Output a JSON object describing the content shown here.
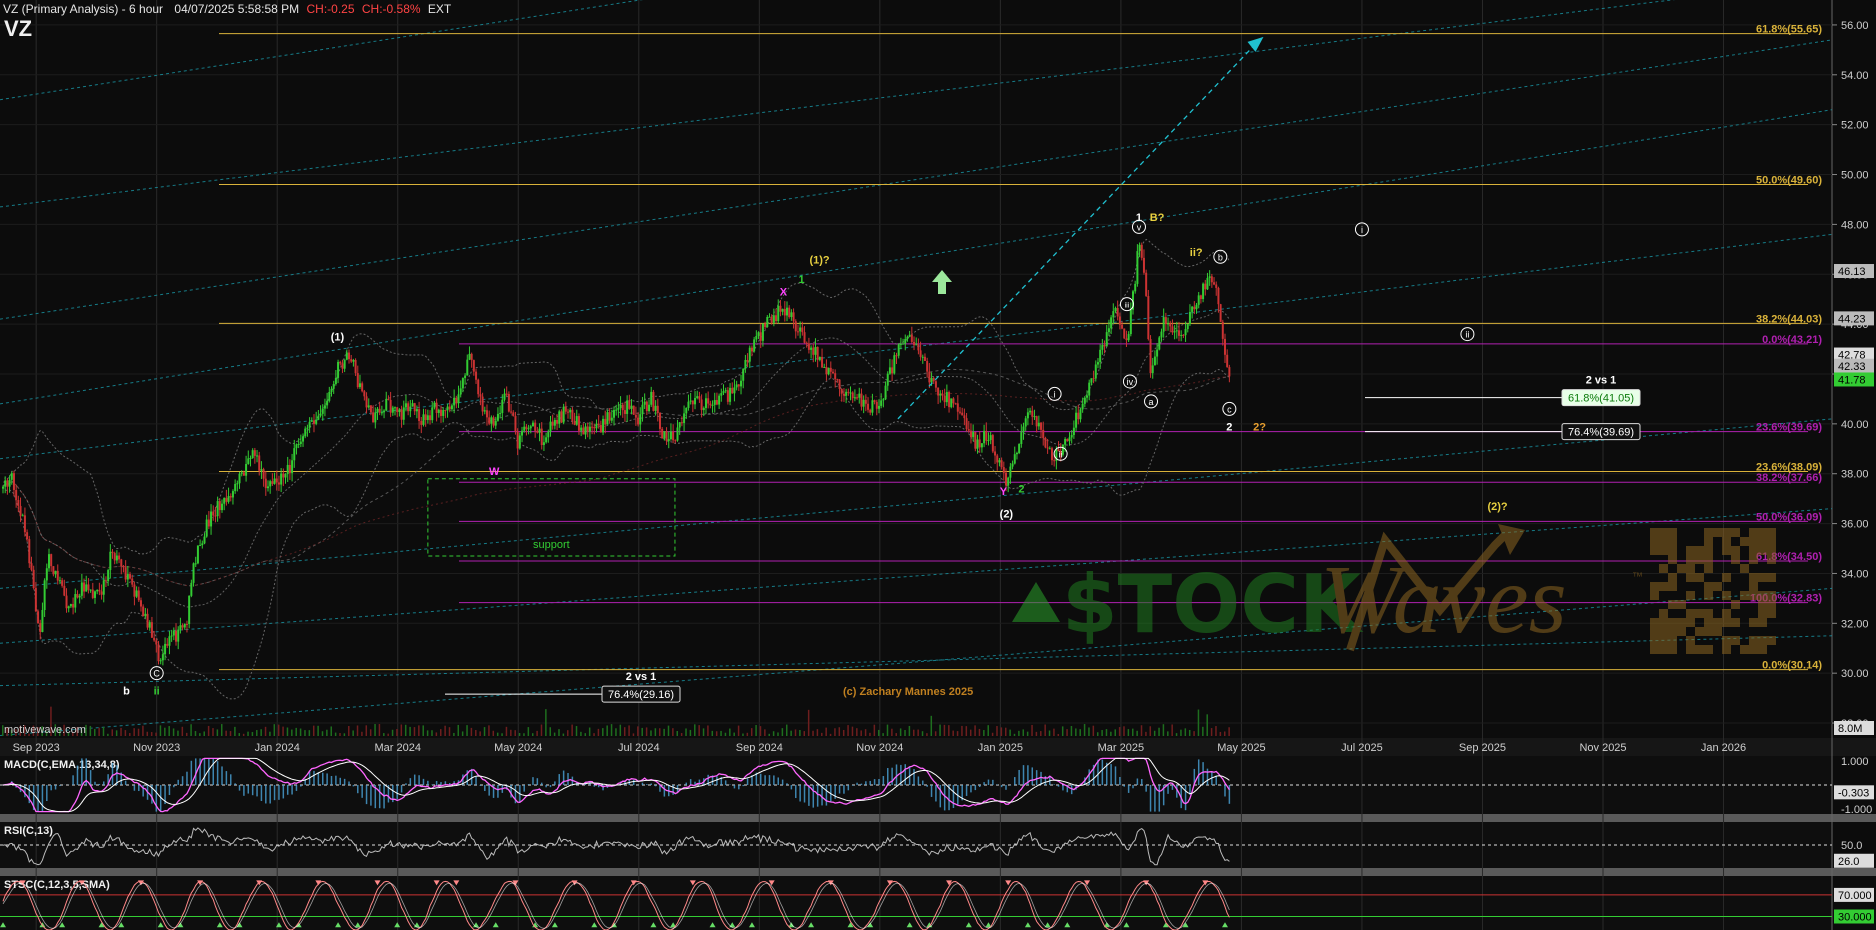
{
  "header": {
    "title": "VZ (Primary Analysis) - 6 hour",
    "datetime": "04/07/2025 5:58:58 PM",
    "change": "CH:-0.25",
    "change_pct": "CH:-0.58%",
    "session": "EXT",
    "symbol": "VZ"
  },
  "watermark": {
    "site": "motivewave.com",
    "copyright": "(c) Zachary Mannes 2025",
    "logo_text_1": "$TOCK",
    "logo_text_2": "Waves",
    "tm": "™"
  },
  "colors": {
    "background": "#0c0c0c",
    "up_candle": "#33cc33",
    "down_candle": "#cc3333",
    "fib_gold": "#d9b23a",
    "fib_magenta": "#b020b0",
    "channel_cyan": "#1aa0b0",
    "macd_line": "#ff66ff",
    "macd_signal": "#ffffff",
    "macd_hist": "#4aa3d8",
    "rsi_line": "#bbbbbb",
    "stoch_k": "#ff8888",
    "stoch_d": "#ffffff"
  },
  "chart_data": [
    {
      "type": "candlestick",
      "xlabel": "",
      "ylabel": "",
      "x_ticks": [
        "Sep 2023",
        "Nov 2023",
        "Jan 2024",
        "Mar 2024",
        "May 2024",
        "Jul 2024",
        "Sep 2024",
        "Nov 2024",
        "Jan 2025",
        "Mar 2025",
        "May 2025",
        "Jul 2025",
        "Sep 2025",
        "Nov 2025",
        "Jan 2026"
      ],
      "x_tick_months": [
        0,
        2,
        4,
        6,
        8,
        10,
        12,
        14,
        16,
        18,
        20,
        22,
        24,
        26,
        28
      ],
      "x_range_months": [
        -0.6,
        29.8
      ],
      "ylim": [
        27.4,
        57.0
      ],
      "y_ticks": [
        28.0,
        30.0,
        32.0,
        34.0,
        36.0,
        38.0,
        40.0,
        42.0,
        44.0,
        46.0,
        48.0,
        50.0,
        52.0,
        54.0,
        56.0
      ],
      "price_tags": [
        {
          "label": "46.13",
          "value": 46.13,
          "bg": "#bbbbbb",
          "fg": "#000000"
        },
        {
          "label": "44.23",
          "value": 44.23,
          "bg": "#bbbbbb",
          "fg": "#000000"
        },
        {
          "label": "42.78",
          "value": 42.78,
          "bg": "#dddddd",
          "fg": "#000000"
        },
        {
          "label": "42.33",
          "value": 42.33,
          "bg": "#bbbbbb",
          "fg": "#000000"
        },
        {
          "label": "41.78",
          "value": 41.78,
          "bg": "#33cc33",
          "fg": "#000000"
        }
      ],
      "volume_tag": "8.0M",
      "price_path": [
        {
          "m": -0.55,
          "p": 37.4
        },
        {
          "m": -0.4,
          "p": 37.8
        },
        {
          "m": -0.25,
          "p": 36.5
        },
        {
          "m": -0.1,
          "p": 34.5
        },
        {
          "m": 0.05,
          "p": 31.4
        },
        {
          "m": 0.2,
          "p": 34.8
        },
        {
          "m": 0.35,
          "p": 33.8
        },
        {
          "m": 0.55,
          "p": 32.6
        },
        {
          "m": 0.75,
          "p": 33.5
        },
        {
          "m": 0.95,
          "p": 33.0
        },
        {
          "m": 1.1,
          "p": 33.2
        },
        {
          "m": 1.25,
          "p": 35.0
        },
        {
          "m": 1.45,
          "p": 34.2
        },
        {
          "m": 1.65,
          "p": 33.2
        },
        {
          "m": 1.85,
          "p": 32.0
        },
        {
          "m": 2.0,
          "p": 31.0
        },
        {
          "m": 2.05,
          "p": 30.6
        },
        {
          "m": 2.2,
          "p": 31.2
        },
        {
          "m": 2.35,
          "p": 31.6
        },
        {
          "m": 2.5,
          "p": 32.2
        },
        {
          "m": 2.6,
          "p": 34.3
        },
        {
          "m": 2.8,
          "p": 35.8
        },
        {
          "m": 3.0,
          "p": 36.6
        },
        {
          "m": 3.2,
          "p": 37.2
        },
        {
          "m": 3.4,
          "p": 37.8
        },
        {
          "m": 3.6,
          "p": 38.9
        },
        {
          "m": 3.8,
          "p": 37.6
        },
        {
          "m": 4.0,
          "p": 37.8
        },
        {
          "m": 4.2,
          "p": 38.2
        },
        {
          "m": 4.4,
          "p": 39.6
        },
        {
          "m": 4.6,
          "p": 39.9
        },
        {
          "m": 4.8,
          "p": 40.8
        },
        {
          "m": 5.0,
          "p": 42.3
        },
        {
          "m": 5.2,
          "p": 42.8
        },
        {
          "m": 5.4,
          "p": 41.2
        },
        {
          "m": 5.6,
          "p": 40.2
        },
        {
          "m": 5.8,
          "p": 40.9
        },
        {
          "m": 6.0,
          "p": 40.3
        },
        {
          "m": 6.2,
          "p": 40.8
        },
        {
          "m": 6.4,
          "p": 40.1
        },
        {
          "m": 6.6,
          "p": 40.6
        },
        {
          "m": 6.8,
          "p": 40.4
        },
        {
          "m": 7.0,
          "p": 41.2
        },
        {
          "m": 7.2,
          "p": 42.9
        },
        {
          "m": 7.4,
          "p": 40.6
        },
        {
          "m": 7.6,
          "p": 40.1
        },
        {
          "m": 7.8,
          "p": 41.2
        },
        {
          "m": 8.0,
          "p": 39.2
        },
        {
          "m": 8.2,
          "p": 40.0
        },
        {
          "m": 8.4,
          "p": 39.4
        },
        {
          "m": 8.6,
          "p": 40.1
        },
        {
          "m": 8.8,
          "p": 40.5
        },
        {
          "m": 9.0,
          "p": 40.0
        },
        {
          "m": 9.2,
          "p": 39.6
        },
        {
          "m": 9.4,
          "p": 39.9
        },
        {
          "m": 9.6,
          "p": 40.6
        },
        {
          "m": 9.8,
          "p": 40.7
        },
        {
          "m": 10.0,
          "p": 40.2
        },
        {
          "m": 10.2,
          "p": 41.1
        },
        {
          "m": 10.4,
          "p": 39.6
        },
        {
          "m": 10.6,
          "p": 39.3
        },
        {
          "m": 10.8,
          "p": 40.8
        },
        {
          "m": 11.0,
          "p": 40.9
        },
        {
          "m": 11.2,
          "p": 40.6
        },
        {
          "m": 11.4,
          "p": 41.1
        },
        {
          "m": 11.6,
          "p": 41.2
        },
        {
          "m": 11.8,
          "p": 42.6
        },
        {
          "m": 12.0,
          "p": 43.5
        },
        {
          "m": 12.2,
          "p": 44.3
        },
        {
          "m": 12.4,
          "p": 44.6
        },
        {
          "m": 12.6,
          "p": 44.0
        },
        {
          "m": 12.8,
          "p": 43.3
        },
        {
          "m": 13.0,
          "p": 42.6
        },
        {
          "m": 13.2,
          "p": 42.0
        },
        {
          "m": 13.4,
          "p": 41.4
        },
        {
          "m": 13.6,
          "p": 41.2
        },
        {
          "m": 13.8,
          "p": 40.6
        },
        {
          "m": 14.0,
          "p": 40.9
        },
        {
          "m": 14.2,
          "p": 42.2
        },
        {
          "m": 14.4,
          "p": 43.6
        },
        {
          "m": 14.6,
          "p": 43.0
        },
        {
          "m": 14.8,
          "p": 42.0
        },
        {
          "m": 15.0,
          "p": 41.2
        },
        {
          "m": 15.2,
          "p": 40.8
        },
        {
          "m": 15.4,
          "p": 40.0
        },
        {
          "m": 15.6,
          "p": 39.2
        },
        {
          "m": 15.8,
          "p": 39.6
        },
        {
          "m": 16.0,
          "p": 38.2
        },
        {
          "m": 16.1,
          "p": 37.8
        },
        {
          "m": 16.3,
          "p": 39.2
        },
        {
          "m": 16.5,
          "p": 40.6
        },
        {
          "m": 16.7,
          "p": 39.5
        },
        {
          "m": 16.9,
          "p": 38.6
        },
        {
          "m": 17.1,
          "p": 39.4
        },
        {
          "m": 17.3,
          "p": 40.4
        },
        {
          "m": 17.5,
          "p": 41.7
        },
        {
          "m": 17.7,
          "p": 43.2
        },
        {
          "m": 17.9,
          "p": 44.5
        },
        {
          "m": 18.1,
          "p": 43.0
        },
        {
          "m": 18.3,
          "p": 47.2
        },
        {
          "m": 18.4,
          "p": 45.8
        },
        {
          "m": 18.5,
          "p": 41.7
        },
        {
          "m": 18.7,
          "p": 44.2
        },
        {
          "m": 18.9,
          "p": 43.4
        },
        {
          "m": 19.1,
          "p": 43.9
        },
        {
          "m": 19.3,
          "p": 45.2
        },
        {
          "m": 19.5,
          "p": 45.9
        },
        {
          "m": 19.6,
          "p": 45.4
        },
        {
          "m": 19.7,
          "p": 43.2
        },
        {
          "m": 19.8,
          "p": 41.78
        }
      ]
    },
    {
      "type": "line",
      "title": "MACD(C,EMA,13,34,8)",
      "ylim": [
        -1.2,
        1.2
      ],
      "ticks": [
        {
          "label": "1.000",
          "value": 1.0,
          "tag": false
        },
        {
          "label": "-0.303",
          "value": -0.303,
          "tag": true,
          "bg": "#dddddd"
        },
        {
          "label": "-1.000",
          "value": -1.0,
          "tag": false
        }
      ]
    },
    {
      "type": "line",
      "title": "RSI(C,13)",
      "ylim": [
        15,
        85
      ],
      "ticks": [
        {
          "label": "50.0",
          "value": 50,
          "tag": false
        },
        {
          "label": "26.0",
          "value": 26,
          "tag": true,
          "bg": "#dddddd"
        }
      ]
    },
    {
      "type": "line",
      "title": "STSC(C,12,3,5,SMA)",
      "ylim": [
        5,
        105
      ],
      "ticks": [
        {
          "label": "70.000",
          "value": 70,
          "tag": true,
          "bg": "#dddddd"
        },
        {
          "label": "30.000",
          "value": 30,
          "tag": true,
          "bg": "#33cc33"
        }
      ]
    }
  ],
  "fib_levels": [
    {
      "label": "61.8%(55.65)",
      "value": 55.65,
      "color": "gold"
    },
    {
      "label": "50.0%(49.60)",
      "value": 49.6,
      "color": "gold"
    },
    {
      "label": "38.2%(44.03)",
      "value": 44.03,
      "color": "gold"
    },
    {
      "label": "0.0%(43.21)",
      "value": 43.21,
      "color": "magenta"
    },
    {
      "label": "23.6%(39.69)",
      "value": 39.69,
      "color": "magenta"
    },
    {
      "label": "23.6%(38.09)",
      "value": 38.09,
      "color": "gold"
    },
    {
      "label": "38.2%(37.66)",
      "value": 37.66,
      "color": "magenta"
    },
    {
      "label": "50.0%(36.09)",
      "value": 36.09,
      "color": "magenta"
    },
    {
      "label": "61.8%(34.50)",
      "value": 34.5,
      "color": "magenta"
    },
    {
      "label": "100.0%(32.83)",
      "value": 32.83,
      "color": "magenta"
    },
    {
      "label": "0.0%(30.14)",
      "value": 30.14,
      "color": "gold"
    }
  ],
  "target_boxes": [
    {
      "label": "61.8%(41.05)",
      "value": 41.05,
      "heading": "2 vs 1",
      "style": "green"
    },
    {
      "label": "76.4%(39.69)",
      "value": 39.69,
      "heading": "",
      "style": "white"
    },
    {
      "label": "76.4%(29.16)",
      "value": 29.16,
      "heading": "2 vs 1",
      "style": "white"
    }
  ],
  "support_box": {
    "label": "support",
    "m0": 6.5,
    "m1": 10.6,
    "p_top": 37.8,
    "p_bottom": 34.7
  },
  "wave_labels": [
    {
      "text": "(1)",
      "m": 5.0,
      "p": 43.5,
      "color": "#ffffff",
      "circle": false
    },
    {
      "text": "W",
      "m": 7.6,
      "p": 38.1,
      "color": "#ff44ff",
      "circle": false
    },
    {
      "text": "X",
      "m": 12.4,
      "p": 45.3,
      "color": "#ff44ff",
      "circle": false
    },
    {
      "text": "1",
      "m": 12.7,
      "p": 45.8,
      "color": "#33cc33",
      "circle": false
    },
    {
      "text": "(1)?",
      "m": 13.0,
      "p": 46.6,
      "color": "#e8d040",
      "circle": false
    },
    {
      "text": "Y",
      "m": 16.05,
      "p": 37.3,
      "color": "#ff44ff",
      "circle": false
    },
    {
      "text": "2",
      "m": 16.35,
      "p": 37.4,
      "color": "#33cc33",
      "circle": false
    },
    {
      "text": "(2)",
      "m": 16.1,
      "p": 36.4,
      "color": "#ffffff",
      "circle": false
    },
    {
      "text": "1",
      "m": 18.3,
      "p": 48.3,
      "color": "#ffffff",
      "circle": false
    },
    {
      "text": "B?",
      "m": 18.6,
      "p": 48.3,
      "color": "#e8d040",
      "circle": false
    },
    {
      "text": "v",
      "m": 18.3,
      "p": 47.9,
      "color": "#ffffff",
      "circle": true
    },
    {
      "text": "iii",
      "m": 18.1,
      "p": 44.8,
      "color": "#ffffff",
      "circle": true
    },
    {
      "text": "iv",
      "m": 18.15,
      "p": 41.7,
      "color": "#ffffff",
      "circle": true
    },
    {
      "text": "i",
      "m": 16.9,
      "p": 41.2,
      "color": "#ffffff",
      "circle": true
    },
    {
      "text": "ii",
      "m": 17.0,
      "p": 38.8,
      "color": "#ffffff",
      "circle": true
    },
    {
      "text": "a",
      "m": 18.5,
      "p": 40.9,
      "color": "#ffffff",
      "circle": true
    },
    {
      "text": "ii?",
      "m": 19.25,
      "p": 46.9,
      "color": "#e8d040",
      "circle": false
    },
    {
      "text": "b",
      "m": 19.65,
      "p": 46.7,
      "color": "#ffffff",
      "circle": true
    },
    {
      "text": "c",
      "m": 19.8,
      "p": 40.6,
      "color": "#ffffff",
      "circle": true
    },
    {
      "text": "2",
      "m": 19.8,
      "p": 39.9,
      "color": "#ffffff",
      "circle": false
    },
    {
      "text": "2?",
      "m": 20.3,
      "p": 39.9,
      "color": "#e8a030",
      "circle": false
    },
    {
      "text": "i",
      "m": 22.0,
      "p": 47.8,
      "color": "#ffffff",
      "circle": true
    },
    {
      "text": "ii",
      "m": 23.75,
      "p": 43.6,
      "color": "#ffffff",
      "circle": true
    },
    {
      "text": "(2)?",
      "m": 24.25,
      "p": 36.7,
      "color": "#e8d040",
      "circle": false
    },
    {
      "text": "C",
      "m": 2.0,
      "p": 30.0,
      "color": "#ffffff",
      "circle": true
    },
    {
      "text": "ii",
      "m": 2.0,
      "p": 29.3,
      "color": "#33cc33",
      "circle": false
    },
    {
      "text": "b",
      "m": 1.5,
      "p": 29.3,
      "color": "#ffffff",
      "circle": false
    }
  ]
}
